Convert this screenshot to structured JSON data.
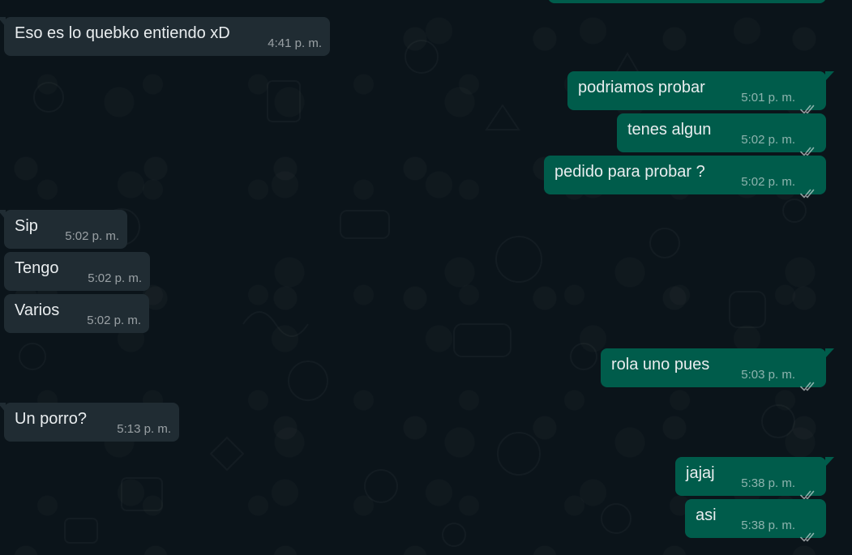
{
  "colors": {
    "background": "#0b141a",
    "incoming_bubble": "#202c33",
    "outgoing_bubble": "#005c4b",
    "text": "#e9edef",
    "meta": "#8696a0"
  },
  "icons": {
    "read_receipt": "double-check-icon"
  },
  "messages": [
    {
      "direction": "in",
      "text": "Eso es lo quebko entiendo xD",
      "time": "4:41 p. m."
    },
    {
      "direction": "out",
      "text": "podriamos probar",
      "time": "5:01 p. m."
    },
    {
      "direction": "out",
      "text": "tenes algun",
      "time": "5:02 p. m."
    },
    {
      "direction": "out",
      "text": "pedido para probar ?",
      "time": "5:02 p. m."
    },
    {
      "direction": "in",
      "text": "Sip",
      "time": "5:02 p. m."
    },
    {
      "direction": "in",
      "text": "Tengo",
      "time": "5:02 p. m."
    },
    {
      "direction": "in",
      "text": "Varios",
      "time": "5:02 p. m."
    },
    {
      "direction": "out",
      "text": "rola uno pues",
      "time": "5:03 p. m."
    },
    {
      "direction": "in",
      "text": "Un porro?",
      "time": "5:13 p. m."
    },
    {
      "direction": "out",
      "text": "jajaj",
      "time": "5:38 p. m."
    },
    {
      "direction": "out",
      "text": "asi",
      "time": "5:38 p. m."
    }
  ]
}
